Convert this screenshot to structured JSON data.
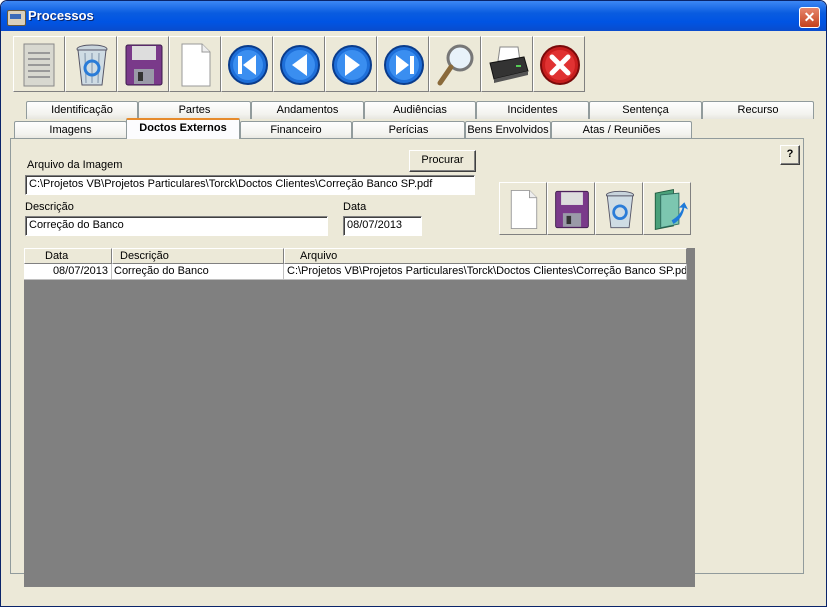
{
  "window": {
    "title": "Processos",
    "close_label": "✕"
  },
  "toolbar": [
    {
      "name": "report-doc-button"
    },
    {
      "name": "delete-button"
    },
    {
      "name": "save-button"
    },
    {
      "name": "new-button"
    },
    {
      "name": "first-record-button"
    },
    {
      "name": "previous-record-button"
    },
    {
      "name": "next-record-button"
    },
    {
      "name": "last-record-button"
    },
    {
      "name": "search-button"
    },
    {
      "name": "print-button"
    },
    {
      "name": "exit-button"
    }
  ],
  "tabs_row1": [
    "Identificação",
    "Partes",
    "Andamentos",
    "Audiências",
    "Incidentes",
    "Sentença",
    "Recurso"
  ],
  "tabs_row2": [
    "Imagens",
    "Doctos Externos",
    "Financeiro",
    "Perícias",
    "Bens Envolvidos",
    "Atas / Reuniões"
  ],
  "active_tab": "Doctos Externos",
  "form": {
    "help_label": "?",
    "file_label": "Arquivo da Imagem",
    "browse_label": "Procurar",
    "file_value": "C:\\Projetos VB\\Projetos Particulares\\Torck\\Doctos Clientes\\Correção Banco SP.pdf",
    "description_label": "Descrição",
    "description_value": "Correção do Banco",
    "date_label": "Data",
    "date_value": "08/07/2013"
  },
  "grid": {
    "columns": [
      "Data",
      "Descrição",
      "Arquivo"
    ],
    "rows": [
      {
        "date": "08/07/2013",
        "description": "Correção do Banco",
        "file": "C:\\Projetos VB\\Projetos Particulares\\Torck\\Doctos Clientes\\Correção Banco SP.pdf"
      }
    ]
  },
  "colors": {
    "titlebar": "#0054e3",
    "face": "#ece9d8",
    "grid_bg": "#808080",
    "active_tab_accent": "#e68b2c"
  }
}
